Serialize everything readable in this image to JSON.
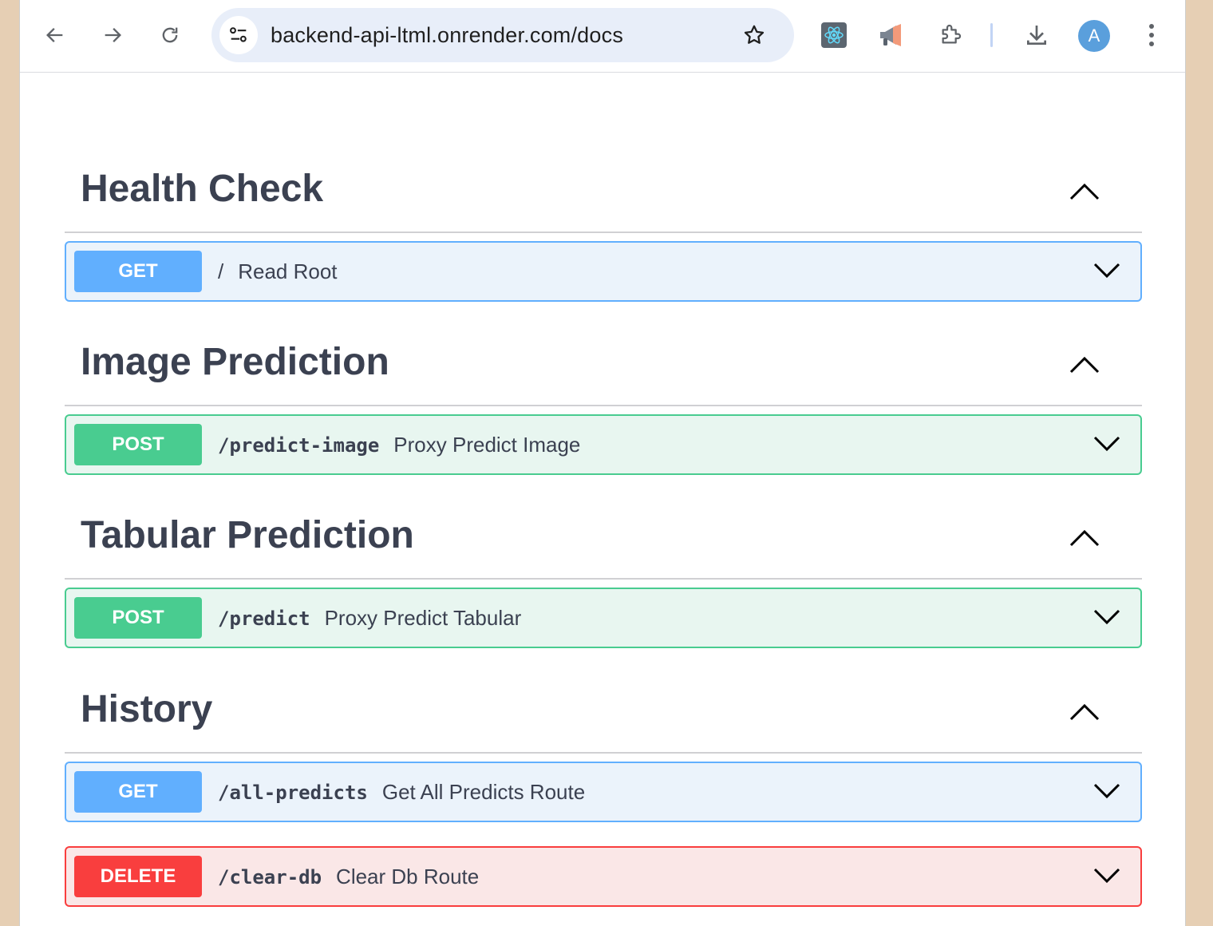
{
  "browser": {
    "url": "backend-api-ltml.onrender.com/docs",
    "profile_initial": "A",
    "icons": [
      "back-arrow-icon",
      "forward-arrow-icon",
      "reload-icon",
      "site-settings-icon",
      "bookmark-star-icon",
      "react-devtools-icon",
      "megaphone-icon",
      "extensions-icon",
      "download-icon",
      "kebab-menu-icon"
    ]
  },
  "sections": [
    {
      "title": "Health Check",
      "operations": [
        {
          "method": "GET",
          "path": "/",
          "summary": "Read Root",
          "path_style": "plain"
        }
      ]
    },
    {
      "title": "Image Prediction",
      "operations": [
        {
          "method": "POST",
          "path": "/predict-image",
          "summary": "Proxy Predict Image"
        }
      ]
    },
    {
      "title": "Tabular Prediction",
      "operations": [
        {
          "method": "POST",
          "path": "/predict",
          "summary": "Proxy Predict Tabular"
        }
      ]
    },
    {
      "title": "History",
      "operations": [
        {
          "method": "GET",
          "path": "/all-predicts",
          "summary": "Get All Predicts Route"
        },
        {
          "method": "DELETE",
          "path": "/clear-db",
          "summary": "Clear Db Route"
        }
      ]
    }
  ],
  "colors": {
    "get": "#61affe",
    "post": "#49cc90",
    "delete": "#f93e3e",
    "title_text": "#3b4151"
  }
}
